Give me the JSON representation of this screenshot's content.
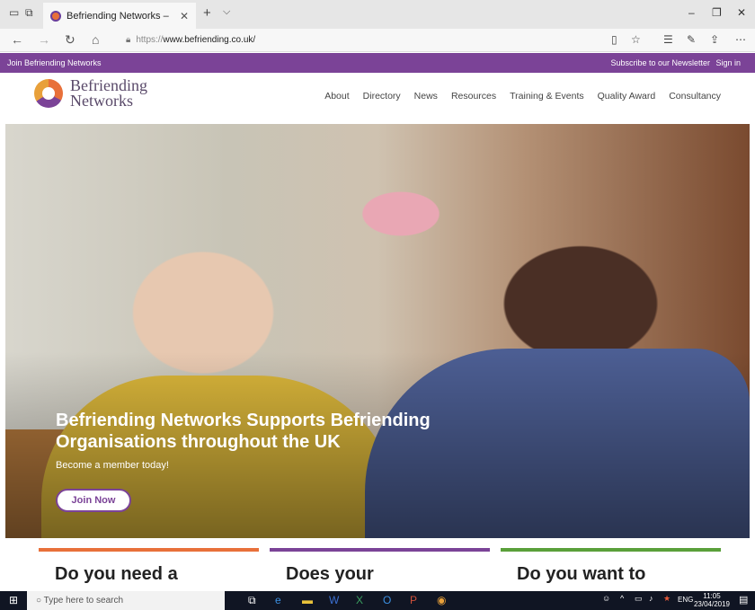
{
  "browser": {
    "tab_title": "Befriending Networks –",
    "address": "https://www.befriending.co.uk/",
    "address_scheme": "https://",
    "address_host": "www.befriending.co.uk/",
    "icons": [
      "back-icon",
      "forward-icon",
      "refresh-icon",
      "home-icon",
      "lock-icon",
      "reading-view-icon",
      "favorite-icon",
      "favorites-hub-icon",
      "pen-icon",
      "share-icon",
      "more-icon"
    ]
  },
  "topbar": {
    "join": "Join Befriending Networks",
    "subscribe": "Subscribe to our Newsletter",
    "signin": "Sign in"
  },
  "site": {
    "logo_line1": "Befriending",
    "logo_line2": "Networks",
    "nav": [
      "About",
      "Directory",
      "News",
      "Resources",
      "Training & Events",
      "Quality Award",
      "Consultancy"
    ]
  },
  "hero": {
    "headline": "Befriending Networks Supports Befriending Organisations throughout the UK",
    "subtext": "Become a member today!",
    "cta": "Join Now"
  },
  "cards": [
    {
      "title": "Do you need a",
      "color": "#e8703a"
    },
    {
      "title": "Does your",
      "color": "#7b4397"
    },
    {
      "title": "Do you want to",
      "color": "#5aa03a"
    }
  ],
  "taskbar": {
    "search_placeholder": "Type here to search",
    "lang": "ENG",
    "time": "11:05",
    "date": "23/04/2019"
  }
}
